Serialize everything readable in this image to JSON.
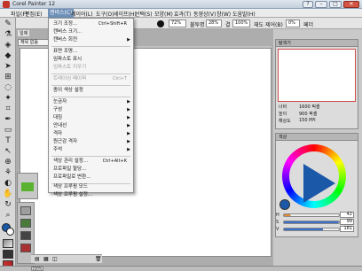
{
  "window": {
    "title": "Corel Painter 12",
    "buttons": {
      "help": "?",
      "minimize": "–",
      "maximize": "□",
      "close": "✕"
    }
  },
  "menubar": {
    "items": [
      "파일(F)",
      "편집(E)",
      "캔버스(C)",
      "레이어(L)",
      "도구(O)",
      "셰이프(H)",
      "선택(S)",
      "모양(M)",
      "효과(T)",
      "동영상(V)",
      "창(W)",
      "도움말(H)"
    ]
  },
  "propbar": {
    "labels": {
      "opacity": "불투명",
      "grain": "결",
      "blend": "재도 제어(B)",
      "feather": "페더"
    },
    "values": {
      "size": "72%",
      "opacity": "28%",
      "grain": "100%",
      "blend": "0%"
    }
  },
  "document": {
    "tab_label": "제목 없음",
    "sub_label": "일제"
  },
  "canvas_menu": {
    "items": [
      {
        "label": "크기 조정...",
        "shortcut": "Ctrl+Shift+R",
        "submenu": false,
        "disabled": false
      },
      {
        "label": "캔버스 크기...",
        "shortcut": "",
        "submenu": false,
        "disabled": false
      },
      {
        "label": "캔버스 회전",
        "shortcut": "",
        "submenu": true,
        "disabled": false
      },
      {
        "label": "표면 조명...",
        "shortcut": "",
        "submenu": false,
        "disabled": false
      },
      {
        "label": "임파스토 표시",
        "shortcut": "",
        "submenu": false,
        "disabled": false
      },
      {
        "label": "임파스토 지우기",
        "shortcut": "",
        "submenu": false,
        "disabled": true
      },
      {
        "label": "트레이싱 페이퍼",
        "shortcut": "Ctrl+T",
        "submenu": false,
        "disabled": true
      },
      {
        "label": "종이 색상 설정",
        "shortcut": "",
        "submenu": false,
        "disabled": false
      },
      {
        "label": "눈금자",
        "shortcut": "",
        "submenu": true,
        "disabled": false
      },
      {
        "label": "구성",
        "shortcut": "",
        "submenu": true,
        "disabled": false
      },
      {
        "label": "대칭",
        "shortcut": "",
        "submenu": true,
        "disabled": false
      },
      {
        "label": "안내선",
        "shortcut": "",
        "submenu": true,
        "disabled": false
      },
      {
        "label": "격자",
        "shortcut": "",
        "submenu": true,
        "disabled": false
      },
      {
        "label": "원근감 격자",
        "shortcut": "",
        "submenu": true,
        "disabled": false
      },
      {
        "label": "주석",
        "shortcut": "",
        "submenu": true,
        "disabled": false
      },
      {
        "label": "색상 관리 설정...",
        "shortcut": "Ctrl+Alt+K",
        "submenu": false,
        "disabled": false
      },
      {
        "label": "프로파일 할당...",
        "shortcut": "",
        "submenu": false,
        "disabled": false
      },
      {
        "label": "프로파일로 변환...",
        "shortcut": "",
        "submenu": false,
        "disabled": false
      },
      {
        "label": "색상 프루핑 모드",
        "shortcut": "",
        "submenu": false,
        "disabled": false
      },
      {
        "label": "색상 프루핑 설정...",
        "shortcut": "",
        "submenu": false,
        "disabled": false
      }
    ]
  },
  "navigator": {
    "title": "탐색기",
    "info": [
      {
        "label": "너비",
        "value": "1600 픽셀"
      },
      {
        "label": "높이",
        "value": "900 픽셀"
      },
      {
        "label": "해상도",
        "value": "150 PPI"
      }
    ]
  },
  "color_panel": {
    "title": "색상",
    "sliders": [
      {
        "label": "H",
        "value": "42",
        "level": 0.12,
        "color": "#d98c3a"
      },
      {
        "label": "S",
        "value": "99",
        "level": 0.99,
        "color": "#3a70c9"
      },
      {
        "label": "V",
        "value": "181",
        "level": 0.71,
        "color": "#3a70c9"
      }
    ],
    "current_color": "#1c58a8"
  },
  "status": {
    "zoom": "100%"
  },
  "colors": {
    "accent": "#6d8fb8",
    "selection_highlight": "#d04a4a"
  }
}
